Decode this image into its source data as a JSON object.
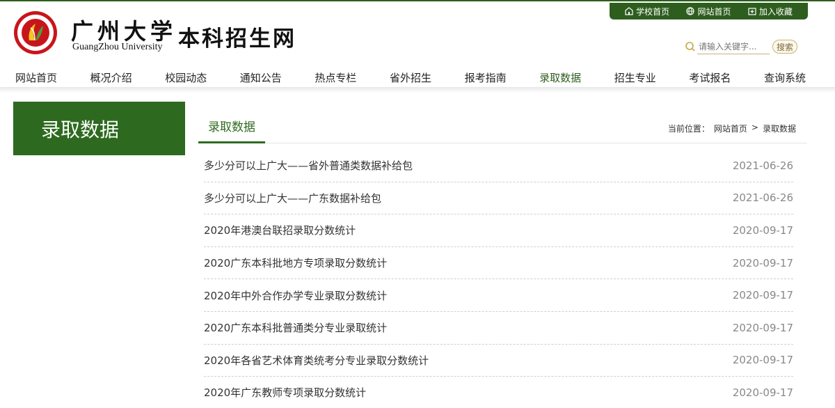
{
  "brand": {
    "cn_name": "广州大学",
    "en_name": "GuangZhou University",
    "site_name": "本科招生网",
    "accent": "#2d5e1e",
    "logo_color": "#c8151b"
  },
  "quick_links": [
    {
      "label": "学校首页",
      "icon": "school-icon"
    },
    {
      "label": "网站首页",
      "icon": "globe-icon"
    },
    {
      "label": "加入收藏",
      "icon": "bookmark-icon"
    }
  ],
  "search": {
    "placeholder": "请输入关键字...",
    "button_label": "搜索"
  },
  "nav": [
    "网站首页",
    "概况介绍",
    "校园动态",
    "通知公告",
    "热点专栏",
    "省外招生",
    "报考指南",
    "录取数据",
    "招生专业",
    "考试报名",
    "查询系统"
  ],
  "sidebar": {
    "title": "录取数据"
  },
  "content": {
    "tab_label": "录取数据",
    "breadcrumb": {
      "prefix": "当前位置：",
      "home": "网站首页",
      "separator": ">",
      "current": "录取数据"
    },
    "items": [
      {
        "title": "多少分可以上广大——省外普通类数据补给包",
        "date": "2021-06-26"
      },
      {
        "title": "多少分可以上广大——广东数据补给包",
        "date": "2021-06-26"
      },
      {
        "title": "2020年港澳台联招录取分数统计",
        "date": "2020-09-17"
      },
      {
        "title": "2020广东本科批地方专项录取分数统计",
        "date": "2020-09-17"
      },
      {
        "title": "2020年中外合作办学专业录取分数统计",
        "date": "2020-09-17"
      },
      {
        "title": "2020广东本科批普通类分专业录取统计",
        "date": "2020-09-17"
      },
      {
        "title": "2020年各省艺术体育类统考分专业录取分数统计",
        "date": "2020-09-17"
      },
      {
        "title": "2020年广东教师专项录取分数统计",
        "date": "2020-09-17"
      }
    ]
  }
}
